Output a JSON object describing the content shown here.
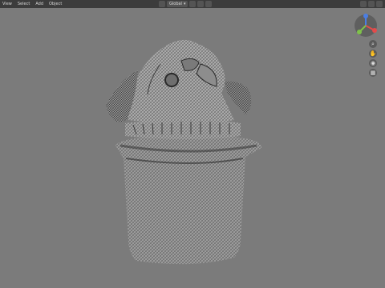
{
  "menu": [
    "View",
    "Select",
    "Add",
    "Object"
  ],
  "header": {
    "orientation": "Global"
  },
  "colors": {
    "viewport_bg": "#7b7b7b",
    "header_bg": "#3c3c3c",
    "axis_x": "#e34b4b",
    "axis_y": "#7fc24a",
    "axis_z": "#4b7ee3"
  },
  "nav_buttons": [
    {
      "icon": "zoom-icon",
      "glyph": "⌕"
    },
    {
      "icon": "pan-hand-icon",
      "glyph": "✋"
    },
    {
      "icon": "camera-icon",
      "glyph": "◉"
    },
    {
      "icon": "grid-icon",
      "glyph": "▦"
    }
  ]
}
